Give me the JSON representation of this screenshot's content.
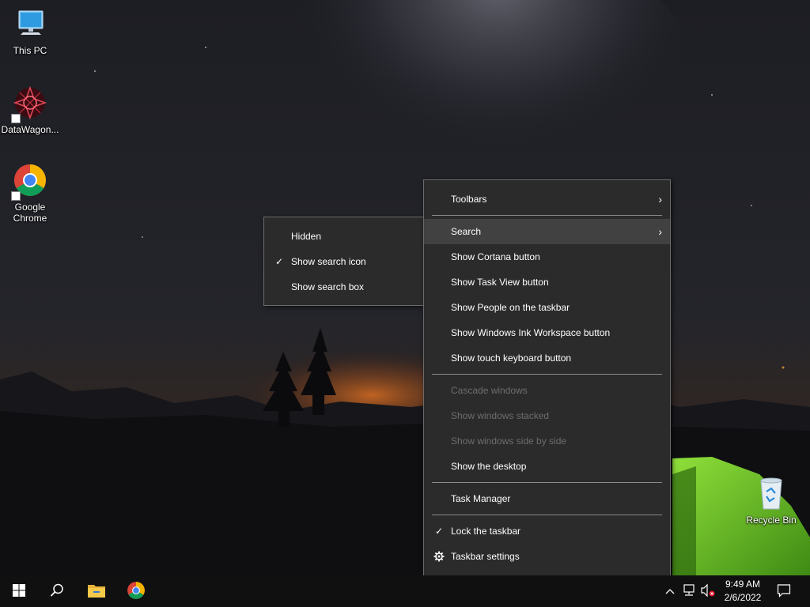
{
  "desktop": {
    "icons": [
      {
        "label": "This PC",
        "icon": "this-pc-icon"
      },
      {
        "label": "DataWagon...",
        "icon": "datawagon-icon",
        "shortcut": true
      },
      {
        "label": "Google Chrome",
        "icon": "chrome-icon",
        "shortcut": true
      },
      {
        "label": "Recycle Bin",
        "icon": "recycle-bin-icon"
      }
    ]
  },
  "taskbar_menu": {
    "items": [
      {
        "label": "Toolbars",
        "has_submenu": true
      },
      {
        "label": "Search",
        "has_submenu": true,
        "highlighted": true
      },
      {
        "label": "Show Cortana button"
      },
      {
        "label": "Show Task View button"
      },
      {
        "label": "Show People on the taskbar"
      },
      {
        "label": "Show Windows Ink Workspace button"
      },
      {
        "label": "Show touch keyboard button"
      },
      {
        "label": "Cascade windows",
        "disabled": true
      },
      {
        "label": "Show windows stacked",
        "disabled": true
      },
      {
        "label": "Show windows side by side",
        "disabled": true
      },
      {
        "label": "Show the desktop"
      },
      {
        "label": "Task Manager"
      },
      {
        "label": "Lock the taskbar",
        "checked": true
      },
      {
        "label": "Taskbar settings",
        "icon": "gear-icon"
      }
    ]
  },
  "search_submenu": {
    "items": [
      {
        "label": "Hidden"
      },
      {
        "label": "Show search icon",
        "checked": true
      },
      {
        "label": "Show search box"
      }
    ]
  },
  "taskbar": {
    "pinned": [
      "start-icon",
      "search-icon",
      "file-explorer-icon",
      "chrome-icon"
    ],
    "tray_icons": [
      "chevron-up-icon",
      "network-icon",
      "volume-muted-icon"
    ],
    "clock": {
      "time": "9:49 AM",
      "date": "2/6/2022"
    },
    "notification_icon": "action-center-icon"
  },
  "glyphs": {
    "check": "✓",
    "chevron": "›"
  },
  "colors": {
    "menu_bg": "#2b2b2b",
    "menu_hover": "#414141",
    "disabled_text": "#6d6d6d",
    "taskbar_bg": "#101010"
  }
}
